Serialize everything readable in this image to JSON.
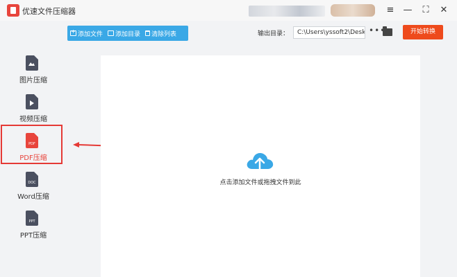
{
  "app": {
    "title": "优速文件压缩器"
  },
  "toolbar": {
    "add_file": "添加文件",
    "add_folder": "添加目录",
    "clear_list": "清除列表",
    "output_label": "输出目录：",
    "output_path": "C:\\Users\\yssoft2\\Deskt",
    "more_label": "•••",
    "start_label": "开始转换"
  },
  "sidebar": {
    "items": [
      {
        "label": "图片压缩",
        "icon": "image-icon",
        "tag": ""
      },
      {
        "label": "视频压缩",
        "icon": "video-icon",
        "tag": ""
      },
      {
        "label": "PDF压缩",
        "icon": "pdf-icon",
        "tag": "PDF",
        "active": true
      },
      {
        "label": "Word压缩",
        "icon": "doc-icon",
        "tag": "DOC"
      },
      {
        "label": "PPT压缩",
        "icon": "ppt-icon",
        "tag": "PPT"
      }
    ]
  },
  "dropzone": {
    "hint": "点击添加文件或拖拽文件到此"
  },
  "colors": {
    "accent": "#3aa8e6",
    "start": "#ee4a1c",
    "active": "#e8453c",
    "annotation": "#e53935"
  },
  "window_controls": {
    "menu": "≡",
    "minimize": "—",
    "maximize": "⛶",
    "close": "✕"
  }
}
